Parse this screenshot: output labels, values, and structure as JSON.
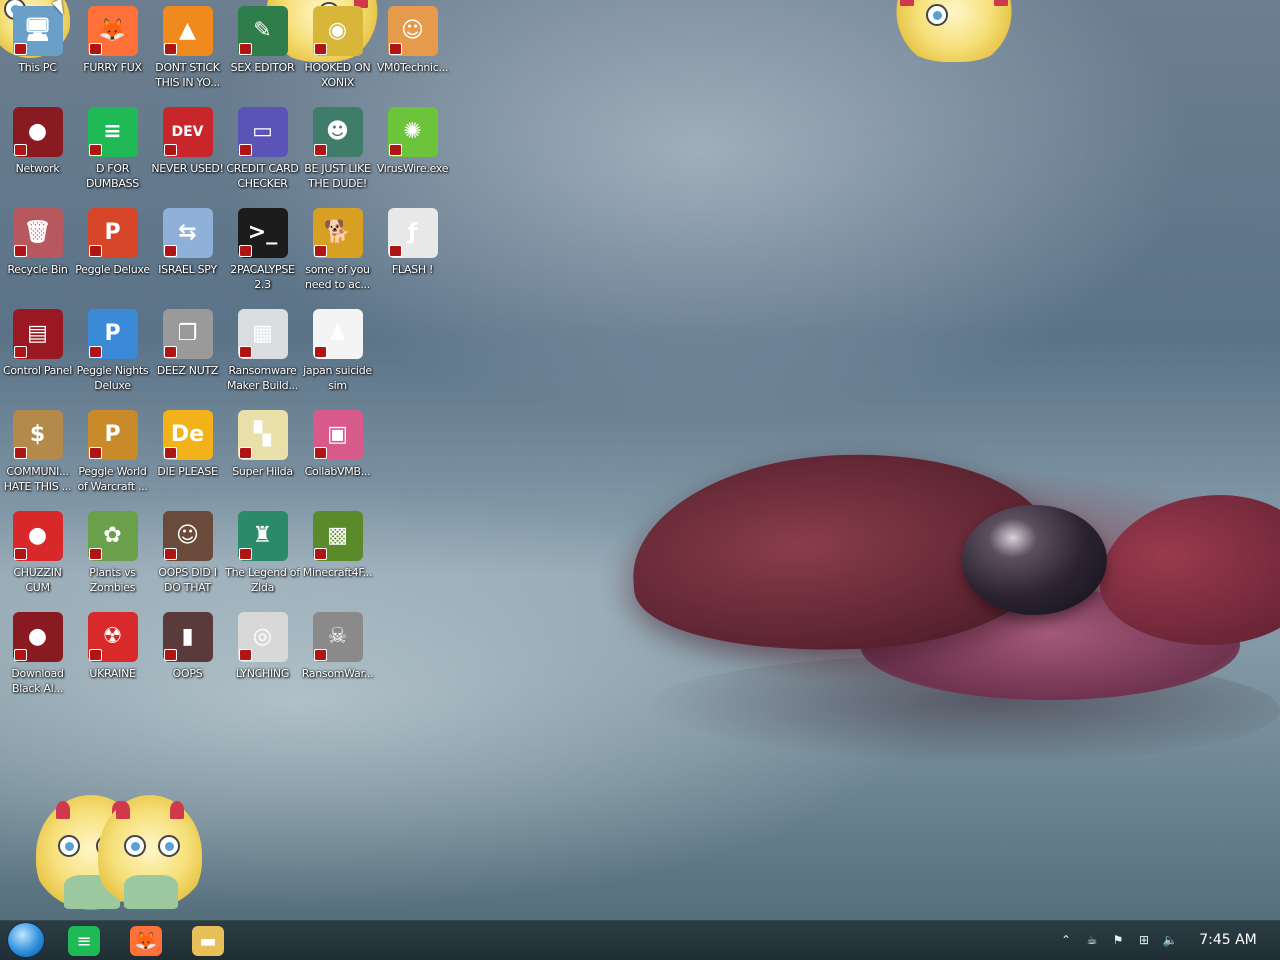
{
  "desktop": {
    "icons": [
      {
        "label": "This PC",
        "icon": "this-pc-icon",
        "glyph": "🖥",
        "color": "#6aa0c8"
      },
      {
        "label": "FURRY FUX",
        "icon": "firefox-icon",
        "glyph": "🦊",
        "color": "#ff7139"
      },
      {
        "label": "DONT STICK THIS IN YO...",
        "icon": "vlc-cone-icon",
        "glyph": "▲",
        "color": "#f08a1c"
      },
      {
        "label": "SEX EDITOR",
        "icon": "editor-icon",
        "glyph": "✎",
        "color": "#2f7d4a"
      },
      {
        "label": "HOOKED ON XONIX",
        "icon": "game-icon",
        "glyph": "◉",
        "color": "#d8b63a"
      },
      {
        "label": "VM0Technic...",
        "icon": "doctor-icon",
        "glyph": "☺",
        "color": "#e59a4c"
      },
      {
        "label": "Network",
        "icon": "network-icon",
        "glyph": "●",
        "color": "#8a1a22"
      },
      {
        "label": "D FOR DUMBASS",
        "icon": "chat-icon",
        "glyph": "≡",
        "color": "#1fb955"
      },
      {
        "label": "NEVER USED!",
        "icon": "dev-cpp-icon",
        "glyph": "DEV",
        "color": "#c9262c"
      },
      {
        "label": "CREDIT CARD CHECKER",
        "icon": "credit-card-icon",
        "glyph": "▭",
        "color": "#5a54b8"
      },
      {
        "label": "BE JUST LIKE THE DUDE!",
        "icon": "dude-icon",
        "glyph": "☻",
        "color": "#3f7d6a"
      },
      {
        "label": "VirusWire.exe",
        "icon": "lime-icon",
        "glyph": "✺",
        "color": "#6cc43a"
      },
      {
        "label": "Recycle Bin",
        "icon": "recycle-bin-icon",
        "glyph": "🗑",
        "color": "#b7585e"
      },
      {
        "label": "Peggle Deluxe",
        "icon": "peggle-icon",
        "glyph": "P",
        "color": "#d8462a"
      },
      {
        "label": "ISRAEL SPY",
        "icon": "remote-desktop-icon",
        "glyph": "⇆",
        "color": "#8fb0d8"
      },
      {
        "label": "2PACALYPSE 2.3",
        "icon": "terminal-icon",
        "glyph": ">_",
        "color": "#1c1c1c"
      },
      {
        "label": "some of you need to ac...",
        "icon": "dog-icon",
        "glyph": "🐕",
        "color": "#d8a022"
      },
      {
        "label": "FLASH !",
        "icon": "flash-icon",
        "glyph": "ƒ",
        "color": "#e8e8e8"
      },
      {
        "label": "Control Panel",
        "icon": "control-panel-icon",
        "glyph": "▤",
        "color": "#9a1822"
      },
      {
        "label": "Peggle Nights Deluxe",
        "icon": "peggle-nights-icon",
        "glyph": "P",
        "color": "#3a8ad8"
      },
      {
        "label": "DEEZ NUTZ",
        "icon": "windows-stack-icon",
        "glyph": "❐",
        "color": "#9a9a9a"
      },
      {
        "label": "Ransomware Maker Build...",
        "icon": "builder-icon",
        "glyph": "▦",
        "color": "#d9dde0"
      },
      {
        "label": "japan suicide sim",
        "icon": "document-icon",
        "glyph": "♟",
        "color": "#f4f4f4"
      },
      {
        "label": "COMMUNI... HATE THIS ...",
        "icon": "money-bag-icon",
        "glyph": "$",
        "color": "#b38a4a"
      },
      {
        "label": "Peggle World of Warcraft ...",
        "icon": "peggle-wow-icon",
        "glyph": "P",
        "color": "#c98a2a"
      },
      {
        "label": "DIE PLEASE",
        "icon": "de-icon",
        "glyph": "De",
        "color": "#f2b21a"
      },
      {
        "label": "Super Hilda",
        "icon": "pixel-cat-icon",
        "glyph": "▚",
        "color": "#e8e0a8"
      },
      {
        "label": "CollabVMB...",
        "icon": "monitor-icon",
        "glyph": "▣",
        "color": "#d85a8a"
      },
      {
        "label": "CHUZZIN CUM",
        "icon": "chuzzle-icon",
        "glyph": "●",
        "color": "#d8282a"
      },
      {
        "label": "Plants vs Zombies",
        "icon": "pvz-icon",
        "glyph": "✿",
        "color": "#6aa04a"
      },
      {
        "label": "OOPS DID I DO THAT",
        "icon": "portrait-icon",
        "glyph": "☺",
        "color": "#6a4a3a"
      },
      {
        "label": "The Legend of Zlda",
        "icon": "pixel-hero-icon",
        "glyph": "♜",
        "color": "#2a8a6a"
      },
      {
        "label": "Minecraft4F...",
        "icon": "minecraft-icon",
        "glyph": "▩",
        "color": "#5a8a2a"
      },
      {
        "label": "Download Black Al...",
        "icon": "download-icon",
        "glyph": "●",
        "color": "#8a1a22"
      },
      {
        "label": "UKRAINE",
        "icon": "radiation-icon",
        "glyph": "☢",
        "color": "#d82a2a"
      },
      {
        "label": "OOPS",
        "icon": "book-icon",
        "glyph": "▮",
        "color": "#5a3a3a"
      },
      {
        "label": "LYNCHING",
        "icon": "noose-icon",
        "glyph": "◎",
        "color": "#d8d8d8"
      },
      {
        "label": "RansomWar...",
        "icon": "skull-icon",
        "glyph": "☠",
        "color": "#8a8a8a"
      }
    ]
  },
  "taskbar": {
    "start": "start-orb-icon",
    "pinned": [
      {
        "name": "chat-app",
        "icon": "chat-icon",
        "glyph": "≡",
        "color": "#1fb955"
      },
      {
        "name": "firefox",
        "icon": "firefox-icon",
        "glyph": "🦊",
        "color": "#ff7139"
      },
      {
        "name": "file-explorer",
        "icon": "folder-icon",
        "glyph": "▬",
        "color": "#e8c05a"
      }
    ],
    "tray": [
      {
        "icon": "chevron-up-icon",
        "glyph": "⌃"
      },
      {
        "icon": "java-icon",
        "glyph": "☕"
      },
      {
        "icon": "flag-icon",
        "glyph": "⚑"
      },
      {
        "icon": "network-icon",
        "glyph": "⊞"
      },
      {
        "icon": "volume-icon",
        "glyph": "🔈"
      }
    ],
    "clock": "7:45 AM"
  },
  "colors": {
    "taskbar_bg": "#1f2e34",
    "label_text": "#ffffff"
  }
}
